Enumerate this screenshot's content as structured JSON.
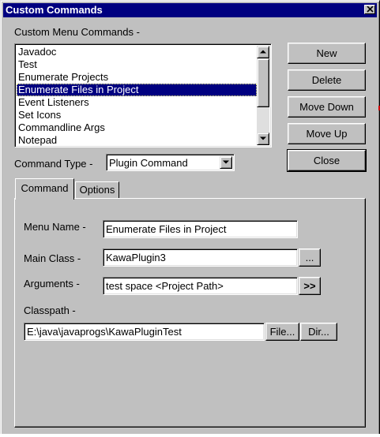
{
  "window": {
    "title": "Custom Commands",
    "close_icon": "close-icon"
  },
  "commands": {
    "label": "Custom Menu Commands -",
    "items": [
      "Javadoc",
      "Test",
      "Enumerate Projects",
      "Enumerate Files in Project",
      "Event Listeners",
      "Set Icons",
      "Commandline Args",
      "Notepad"
    ],
    "selected": "Enumerate Files in Project"
  },
  "buttons": {
    "new": "New",
    "delete": "Delete",
    "move_down": "Move Down",
    "move_up": "Move Up",
    "close": "Close"
  },
  "command_type": {
    "label": "Command Type -",
    "value": "Plugin Command"
  },
  "tabs": [
    {
      "label": "Command",
      "active": true
    },
    {
      "label": "Options",
      "active": false
    }
  ],
  "form": {
    "menu_name": {
      "label": "Menu Name -",
      "value": "Enumerate Files in Project"
    },
    "main_class": {
      "label": "Main Class -",
      "value": "KawaPlugin3",
      "browse": "..."
    },
    "arguments": {
      "label": "Arguments -",
      "value": "test space <Project Path>",
      "insert": ">>"
    },
    "classpath": {
      "label": "Classpath -",
      "value": "E:\\java\\javaprogs\\KawaPluginTest",
      "file": "File...",
      "dir": "Dir..."
    }
  },
  "colors": {
    "face": "#c0c0c0",
    "title_bar": "#000080",
    "selection": "#000080"
  }
}
